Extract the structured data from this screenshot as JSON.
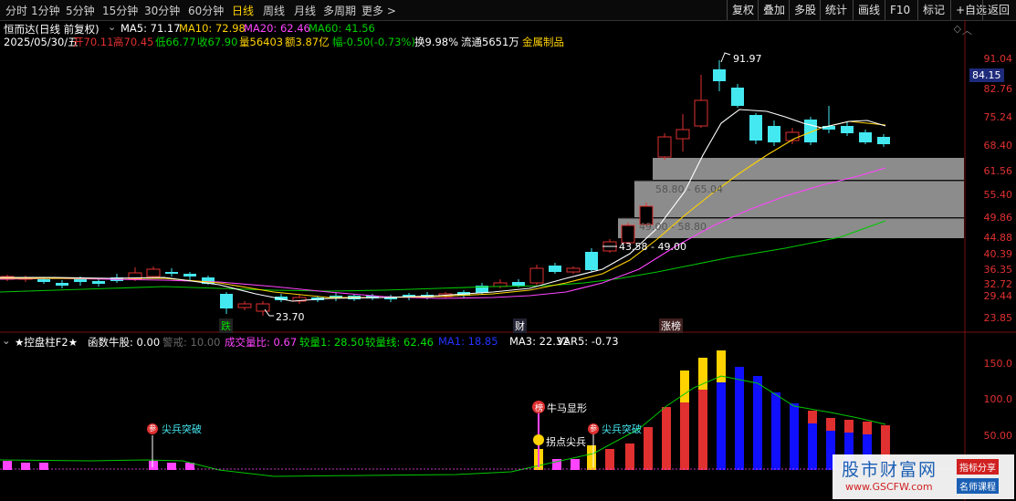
{
  "toolbar": {
    "periods": [
      "分时",
      "1分钟",
      "5分钟",
      "15分钟",
      "30分钟",
      "60分钟",
      "日线",
      "周线",
      "月线",
      "多周期",
      "更多 >"
    ],
    "active_period": "日线",
    "right_buttons": [
      "复权",
      "叠加",
      "多股",
      "统计",
      "画线",
      "F10",
      "标记",
      "+自选",
      "返回"
    ]
  },
  "header": {
    "title": "恒而达(日线 前复权)",
    "ma5": "MA5: 71.17",
    "ma10": "MA10: 72.98",
    "ma20": "MA20: 62.46",
    "ma60": "MA60: 41.56",
    "date": "2025/05/30/五",
    "open": "开70.11",
    "high": "高70.45",
    "low": "低66.77",
    "close": "收67.90",
    "volume": "量56403",
    "amount": "额3.87亿",
    "change": "幅-0.50(-0.73%)",
    "turnover": "换9.98%",
    "float": "流通5651万",
    "sector": "金属制品"
  },
  "price_axis": [
    "91.04",
    "82.76",
    "75.24",
    "68.40",
    "61.56",
    "55.40",
    "49.86",
    "44.88",
    "40.39",
    "36.35",
    "32.72",
    "29.44",
    "23.85"
  ],
  "current_price": "84.15",
  "annotations": {
    "high_label": "91.97",
    "low_label": "23.70",
    "zone1": "43.58 - 49.00",
    "zone2": "49.00 - 58.80",
    "zone3": "58.80 - 65.04"
  },
  "events": {
    "fall": "跌",
    "finance": "财",
    "list": "涨榜"
  },
  "indicator": {
    "title": "★控盘柱F2★",
    "funds": "函数牛股: 0.00",
    "alert": "警戒: 10.00",
    "ratio": "成交量比: 0.67",
    "v1": "较量1: 28.50",
    "vline": "较量线: 62.46",
    "ma1": "MA1: 18.85",
    "ma3": "MA3: 22.32",
    "var5": "VAR5: -0.73",
    "axis": [
      "150.0",
      "100.0",
      "50.00"
    ],
    "signals": [
      "尖兵突破",
      "牛马显形",
      "拐点尖兵",
      "尖兵突破"
    ]
  },
  "watermark": {
    "site": "股市财富网",
    "url": "www.GSCFW.com",
    "tag1": "指标分享",
    "tag2": "名师课程"
  },
  "colors": {
    "up": "#e03030",
    "down": "#44e8f0",
    "ma5": "#ffffff",
    "ma10": "#ffd200",
    "ma20": "#ff44ff",
    "ma60": "#00c800"
  }
}
